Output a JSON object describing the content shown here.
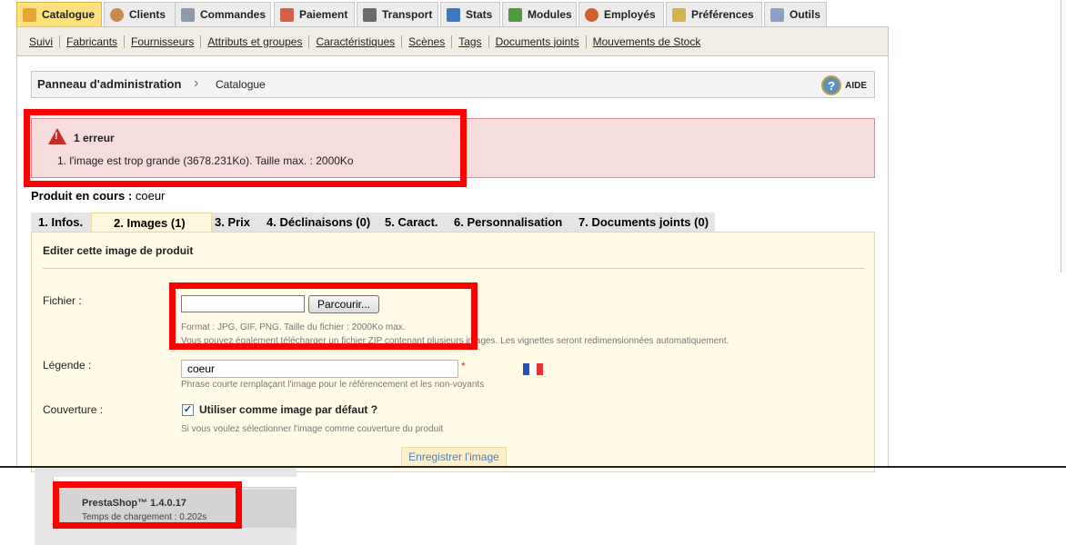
{
  "top_tabs": [
    {
      "label": "Catalogue",
      "icon": "catalog-icon",
      "color": "#e8a531"
    },
    {
      "label": "Clients",
      "icon": "clients-icon",
      "color": "#c98b4b"
    },
    {
      "label": "Commandes",
      "icon": "orders-icon",
      "color": "#8e9aa6"
    },
    {
      "label": "Paiement",
      "icon": "payment-icon",
      "color": "#d4624a"
    },
    {
      "label": "Transport",
      "icon": "truck-icon",
      "color": "#6a6a6a"
    },
    {
      "label": "Stats",
      "icon": "stats-icon",
      "color": "#3b78c2"
    },
    {
      "label": "Modules",
      "icon": "puzzle-icon",
      "color": "#4f9a3f"
    },
    {
      "label": "Employés",
      "icon": "employee-icon",
      "color": "#d0602d"
    },
    {
      "label": "Préférences",
      "icon": "preferences-icon",
      "color": "#d6b24a"
    },
    {
      "label": "Outils",
      "icon": "tools-icon",
      "color": "#8aa0c4"
    }
  ],
  "sub_nav": [
    "Suivi",
    "Fabricants",
    "Fournisseurs",
    "Attributs et groupes",
    "Caractéristiques",
    "Scènes",
    "Tags",
    "Documents joints",
    "Mouvements de Stock"
  ],
  "breadcrumb": {
    "home": "Panneau d'administration",
    "separator": "›",
    "current": "Catalogue"
  },
  "help_label": "AIDE",
  "help_glyph": "?",
  "error": {
    "title": "1 erreur",
    "message": "1.   l'image est trop grande (3678.231Ko). Taille max. : 2000Ko",
    "icon_glyph": "!"
  },
  "product": {
    "label": "Produit en cours :",
    "name": "coeur"
  },
  "product_tabs": [
    "1. Infos.",
    "2. Images (1)",
    "3. Prix",
    "4. Déclinaisons (0)",
    "5. Caract.",
    "6. Personnalisation",
    "7. Documents joints (0)"
  ],
  "form": {
    "title": "Editer cette image de produit",
    "file_label": "Fichier :",
    "browse_label": "Parcourir...",
    "file_hint_1": "Format : JPG, GIF, PNG. Taille du fichier : 2000Ko max.",
    "file_hint_2": "Vous pouvez également télécharger un fichier ZIP contenant plusieurs images. Les vignettes seront redimensionnées automatiquement.",
    "legend_label": "Légende :",
    "legend_value": "coeur",
    "required_mark": "*",
    "legend_hint": "Phrase courte remplaçant l'image pour le référencement et les non-voyants",
    "cover_label": "Couverture :",
    "cover_check_label": "Utiliser comme image par défaut ?",
    "cover_checked": true,
    "cover_hint": "Si vous voulez sélectionner l'image comme couverture du produit",
    "save_label": "Enregistrer l'image"
  },
  "footer": {
    "version": "PrestaShop™ 1.4.0.17",
    "load_time": "Temps de chargement : 0.202s"
  },
  "colors": {
    "highlight": "#ff0000",
    "active_tab": "#ffe27e",
    "error_bg": "#f6dcdc",
    "panel_bg": "#fffbe6",
    "link_blue": "#4e80b7"
  }
}
